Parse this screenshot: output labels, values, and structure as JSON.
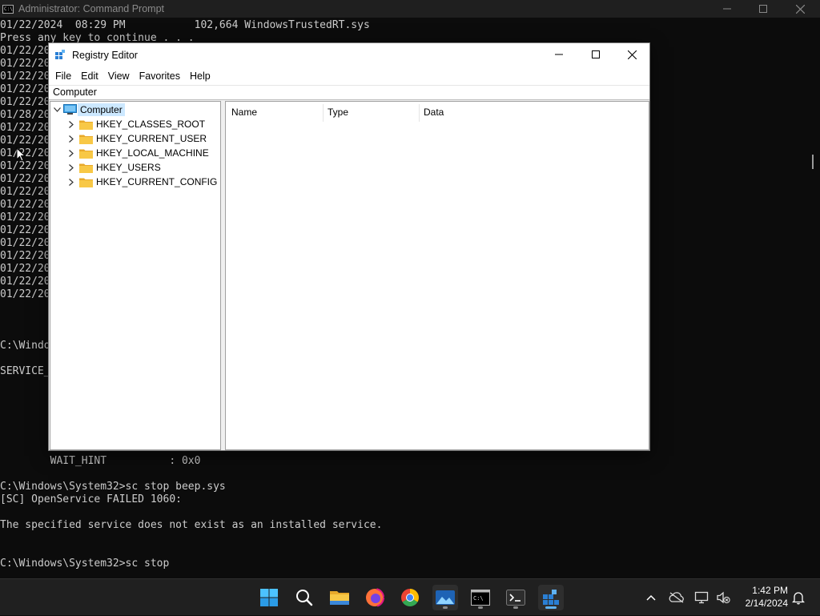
{
  "cmd": {
    "title": "Administrator: Command Prompt",
    "lines": [
      "01/22/2024  08:29 PM           102,664 WindowsTrustedRT.sys",
      "Press any key to continue . . .",
      "01/22/20",
      "01/22/20",
      "01/22/20",
      "01/22/20",
      "01/22/20",
      "01/28/20",
      "01/22/20",
      "01/22/20",
      "01/22/20",
      "01/22/20",
      "01/22/20",
      "01/22/20",
      "01/22/20",
      "01/22/20",
      "01/22/20",
      "01/22/20",
      "01/22/20",
      "01/22/20",
      "01/22/20",
      "01/22/20",
      "C:\\Windo",
      "SERVICE_",
      "        WAIT_HINT          : 0x0",
      "C:\\Windows\\System32>sc stop beep.sys",
      "[SC] OpenService FAILED 1060:",
      "The specified service does not exist as an installed service.",
      "C:\\Windows\\System32>sc stop"
    ]
  },
  "regedit": {
    "title": "Registry Editor",
    "menu": [
      "File",
      "Edit",
      "View",
      "Favorites",
      "Help"
    ],
    "address": "Computer",
    "tree_root": "Computer",
    "tree_items": [
      "HKEY_CLASSES_ROOT",
      "HKEY_CURRENT_USER",
      "HKEY_LOCAL_MACHINE",
      "HKEY_USERS",
      "HKEY_CURRENT_CONFIG"
    ],
    "columns": [
      "Name",
      "Type",
      "Data"
    ]
  },
  "taskbar": {
    "apps": [
      "start-icon",
      "search-icon",
      "file-explorer-icon",
      "firefox-icon",
      "chrome-icon",
      "photos-icon",
      "command-prompt-icon",
      "terminal-icon",
      "registry-editor-icon"
    ],
    "tray": [
      "chevron-up-icon",
      "onedrive-icon",
      "network-icon",
      "volume-muted-icon"
    ],
    "time": "1:42 PM",
    "date": "2/14/2024"
  },
  "colors": {
    "taskbar_bg": "#202020",
    "selection": "#cce8ff",
    "folder": "#f8c846",
    "accent": "#5fb2f2"
  }
}
